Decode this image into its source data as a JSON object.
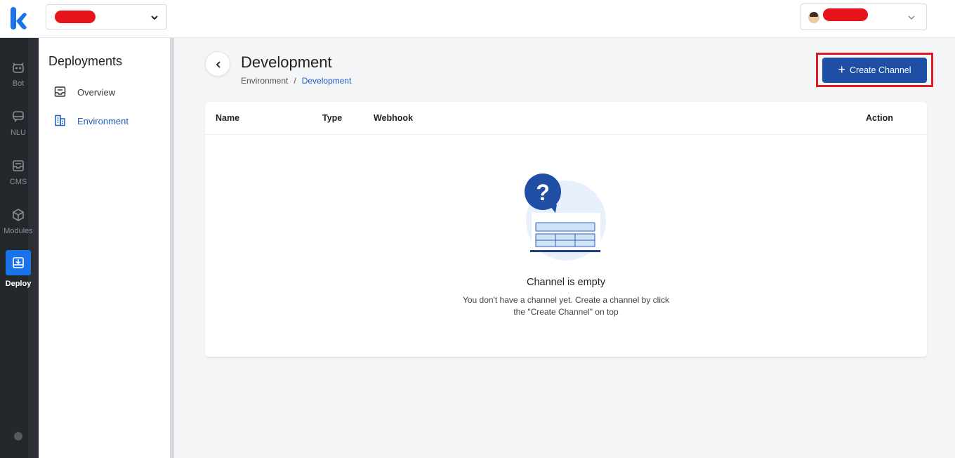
{
  "colors": {
    "primary": "#1f4ea5",
    "rail_bg": "#24282d",
    "rail_active": "#1a73e8",
    "link": "#1d5fbf",
    "highlight_border": "#e01b24"
  },
  "topbar": {
    "logo_icon": "k-logo-icon",
    "workspace_chevron": "chevron-down-icon",
    "user_chevron": "chevron-down-icon"
  },
  "rail": {
    "items": [
      {
        "label": "Bot",
        "icon": "robot-icon"
      },
      {
        "label": "NLU",
        "icon": "chat-icon"
      },
      {
        "label": "CMS",
        "icon": "inbox-icon"
      },
      {
        "label": "Modules",
        "icon": "cube-icon"
      },
      {
        "label": "Deploy",
        "icon": "deploy-icon",
        "active": true
      }
    ]
  },
  "sidebar": {
    "title": "Deployments",
    "items": [
      {
        "label": "Overview",
        "icon": "inbox-tray-icon"
      },
      {
        "label": "Environment",
        "icon": "building-icon",
        "active": true
      }
    ]
  },
  "header": {
    "title": "Development",
    "breadcrumb": [
      "Environment",
      "/",
      "Development"
    ],
    "create_button_label": "Create Channel"
  },
  "table": {
    "columns": [
      "Name",
      "Type",
      "Webhook",
      "Action"
    ],
    "empty_title": "Channel is empty",
    "empty_line1": "You don't have a channel yet. Create a channel by click",
    "empty_line2": "the \"Create Channel\" on top"
  }
}
